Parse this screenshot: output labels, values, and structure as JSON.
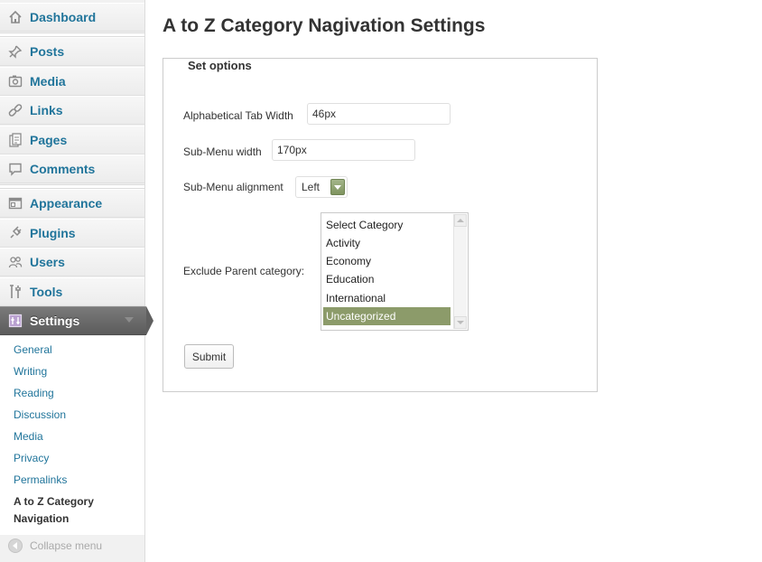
{
  "sidebar": {
    "items": [
      {
        "label": "Dashboard",
        "icon": "home-icon"
      },
      {
        "label": "Posts",
        "icon": "pushpin-icon"
      },
      {
        "label": "Media",
        "icon": "media-icon"
      },
      {
        "label": "Links",
        "icon": "link-icon"
      },
      {
        "label": "Pages",
        "icon": "pages-icon"
      },
      {
        "label": "Comments",
        "icon": "comment-icon"
      },
      {
        "label": "Appearance",
        "icon": "appearance-icon"
      },
      {
        "label": "Plugins",
        "icon": "plugin-icon"
      },
      {
        "label": "Users",
        "icon": "users-icon"
      },
      {
        "label": "Tools",
        "icon": "tools-icon"
      },
      {
        "label": "Settings",
        "icon": "settings-icon",
        "active": true
      }
    ],
    "settings_submenu": [
      "General",
      "Writing",
      "Reading",
      "Discussion",
      "Media",
      "Privacy",
      "Permalinks"
    ],
    "current_submenu": "A to Z Category Navigation",
    "collapse_label": "Collapse menu"
  },
  "main": {
    "title": "A to Z Category Nagivation Settings",
    "fieldset_legend": "Set options",
    "fields": {
      "tab_width_label": "Alphabetical Tab Width",
      "tab_width_value": "46px",
      "submenu_width_label": "Sub-Menu width",
      "submenu_width_value": "170px",
      "submenu_alignment_label": "Sub-Menu alignment",
      "submenu_alignment_value": "Left",
      "exclude_label": "Exclude Parent category:",
      "exclude_options": [
        "Select Category",
        "Activity",
        "Economy",
        "Education",
        "International",
        "Uncategorized"
      ],
      "exclude_selected": "Uncategorized"
    },
    "submit_label": "Submit"
  },
  "colors": {
    "link": "#21759b",
    "active_menu_bg": "#5c5c5c",
    "list_selected_bg": "#8c9b6a"
  }
}
